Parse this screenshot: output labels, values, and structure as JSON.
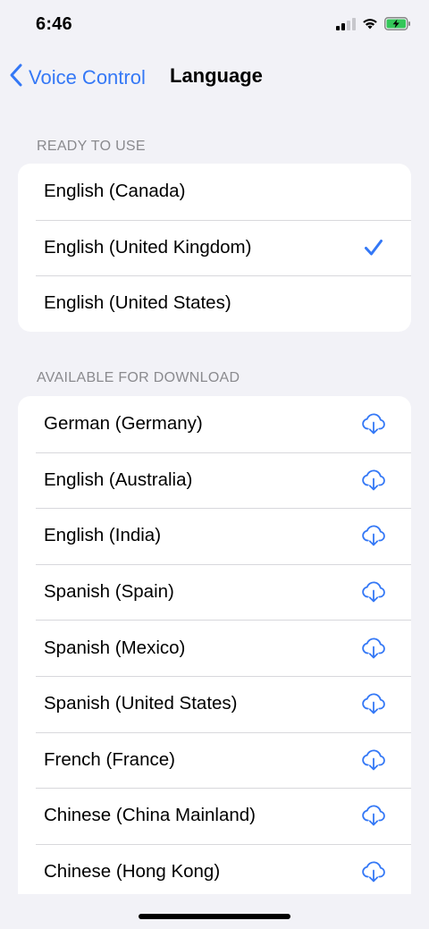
{
  "status_bar": {
    "time": "6:46"
  },
  "nav": {
    "back_label": "Voice Control",
    "title": "Language"
  },
  "ready_section": {
    "header": "READY TO USE",
    "items": [
      {
        "label": "English (Canada)",
        "selected": false
      },
      {
        "label": "English (United Kingdom)",
        "selected": true
      },
      {
        "label": "English (United States)",
        "selected": false
      }
    ]
  },
  "download_section": {
    "header": "AVAILABLE FOR DOWNLOAD",
    "items": [
      {
        "label": "German (Germany)"
      },
      {
        "label": "English (Australia)"
      },
      {
        "label": "English (India)"
      },
      {
        "label": "Spanish (Spain)"
      },
      {
        "label": "Spanish (Mexico)"
      },
      {
        "label": "Spanish (United States)"
      },
      {
        "label": "French (France)"
      },
      {
        "label": "Chinese (China Mainland)"
      },
      {
        "label": "Chinese (Hong Kong)"
      }
    ]
  },
  "colors": {
    "accent": "#3478F6",
    "background": "#F2F2F7",
    "battery": "#34C759"
  },
  "icons": {
    "status": [
      "cellular-signal-icon",
      "wifi-icon",
      "battery-charging-icon"
    ],
    "back": "chevron-left-icon",
    "selected": "checkmark-icon",
    "download": "cloud-download-icon"
  }
}
